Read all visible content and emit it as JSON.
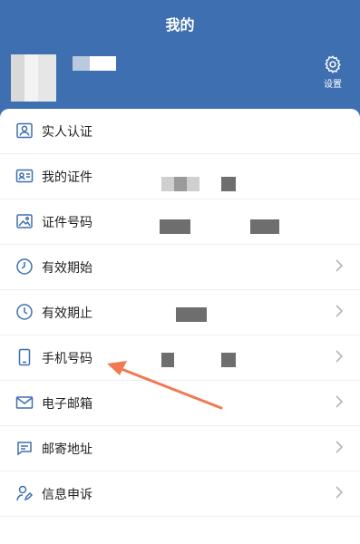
{
  "colors": {
    "accent": "#3e6fb0",
    "icon": "#3e6fb0",
    "arrow": "#f07a52",
    "chevron": "#b5b5b5"
  },
  "header": {
    "title": "我的",
    "settings_label": "设置",
    "settings_icon": "gear-icon"
  },
  "menu": [
    {
      "label": "实人认证",
      "icon": "person-card-icon",
      "chevron": false
    },
    {
      "label": "我的证件",
      "icon": "id-card-icon",
      "chevron": false
    },
    {
      "label": "证件号码",
      "icon": "id-photo-icon",
      "chevron": false
    },
    {
      "label": "有效期始",
      "icon": "clock-icon",
      "chevron": true
    },
    {
      "label": "有效期止",
      "icon": "clock-icon",
      "chevron": true
    },
    {
      "label": "手机号码",
      "icon": "phone-icon",
      "chevron": true
    },
    {
      "label": "电子邮箱",
      "icon": "mail-icon",
      "chevron": true
    },
    {
      "label": "邮寄地址",
      "icon": "address-card-icon",
      "chevron": true
    },
    {
      "label": "信息申诉",
      "icon": "person-edit-icon",
      "chevron": true
    }
  ]
}
